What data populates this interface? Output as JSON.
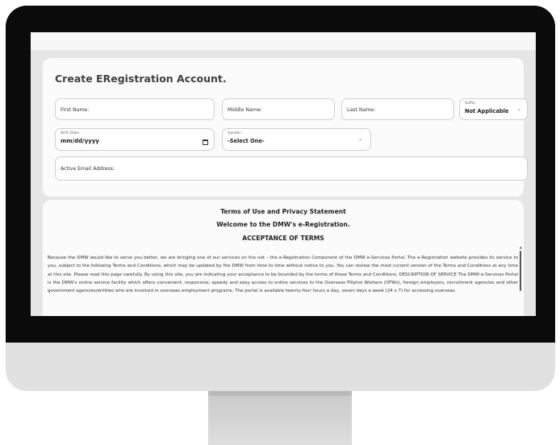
{
  "form": {
    "title": "Create ERegistration Account.",
    "first_name_label": "First Name:",
    "middle_name_label": "Middle Name:",
    "last_name_label": "Last Name:",
    "suffix_label": "Suffix:",
    "suffix_value": "Not Applicable",
    "birth_date_label": "Birth Date:",
    "birth_date_value": "mm/dd/yyyy",
    "gender_label": "Gender:",
    "gender_value": "-Select One-",
    "email_label": "Active Email Address:"
  },
  "terms": {
    "heading1": "Terms of Use and Privacy Statement",
    "heading2": "Welcome to the DMW's e-Registration.",
    "heading3": "ACCEPTANCE OF TERMS",
    "body": "Because the DMW would like to serve you better, we are bringing one of our services on the net – the e-Registration Component of the DMW e-Services Portal. The e-Registration website provides its service to you, subject to the following Terms and Conditions, which may be updated by the DMW from time to time without notice to you. You can review the most current version of the Terms and Conditions at any time at this site. Please read this page carefully. By using this site, you are indicating your acceptance to be bounded by the terms of these Terms and Conditions. DESCRIPTION OF SERVICE The DMW e-Services Portal is the DMW's online service facility which offers convenient, responsive, speedy and easy access to online services to the Overseas Filipino Workers (OFWs), foreign employers, recruitment agencies and other government agencies/entities who are involved in overseas employment programs. The portal is available twenty-four hours a day, seven days a week (24 x 7) for accessing overseas"
  }
}
